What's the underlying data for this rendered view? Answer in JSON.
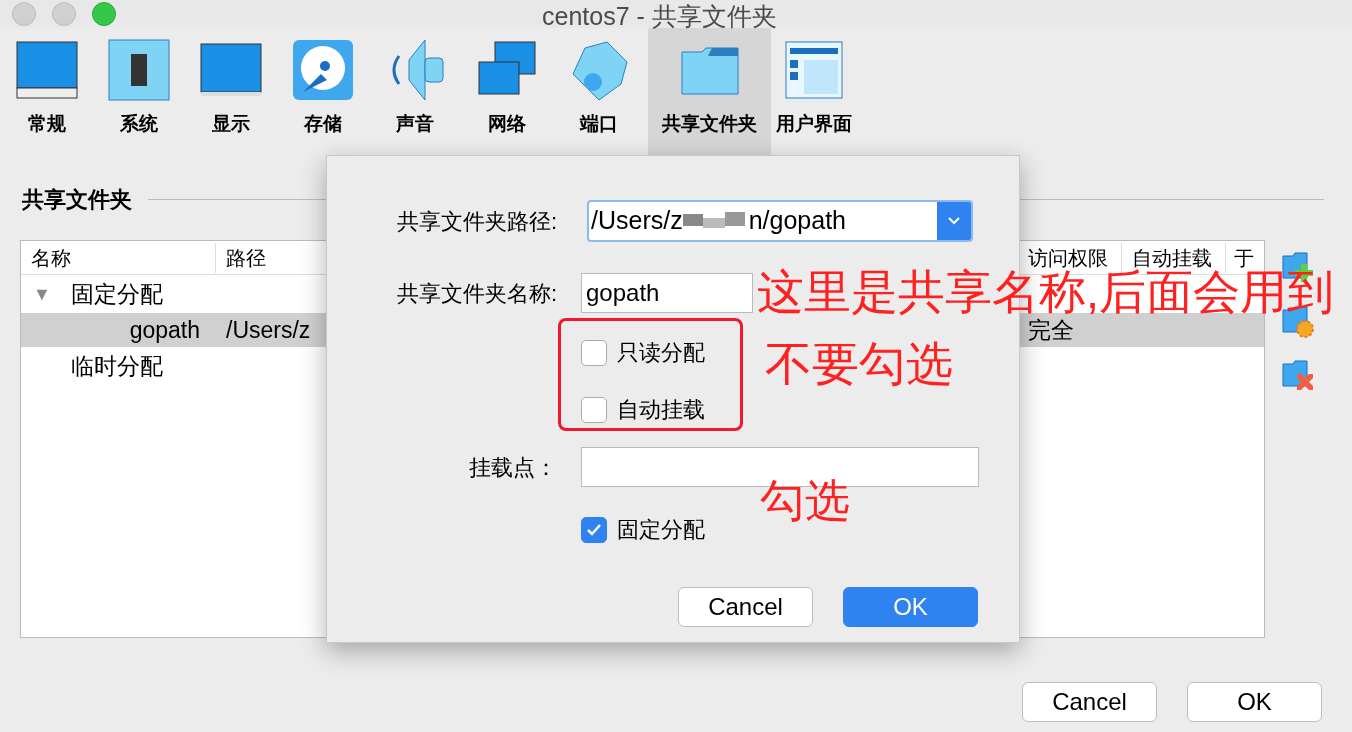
{
  "window": {
    "title": "centos7 - 共享文件夹"
  },
  "toolbar": [
    {
      "label": "常规",
      "kind": "general",
      "selected": false
    },
    {
      "label": "系统",
      "kind": "system",
      "selected": false
    },
    {
      "label": "显示",
      "kind": "display",
      "selected": false
    },
    {
      "label": "存储",
      "kind": "storage",
      "selected": false
    },
    {
      "label": "声音",
      "kind": "audio",
      "selected": false
    },
    {
      "label": "网络",
      "kind": "network",
      "selected": false
    },
    {
      "label": "端口",
      "kind": "ports",
      "selected": false
    },
    {
      "label": "共享文件夹",
      "kind": "shared",
      "selected": true
    },
    {
      "label": "用户界面",
      "kind": "ui",
      "selected": false
    }
  ],
  "section_title": "共享文件夹",
  "table": {
    "columns": [
      "名称",
      "路径",
      "访问权限",
      "自动挂载",
      "于"
    ],
    "groups": [
      {
        "label": "固定分配",
        "toggle": "▼",
        "expanded": true,
        "children": [
          {
            "name": "gopath",
            "path": "/Users/z",
            "access": "完全",
            "selected": true
          }
        ]
      },
      {
        "label": "临时分配"
      }
    ]
  },
  "dialog": {
    "fields": [
      {
        "kind": "combo",
        "label": "共享文件夹路径:",
        "value_start": "/Users/z",
        "value_end": "n/gopath"
      },
      {
        "kind": "text",
        "label": "共享文件夹名称:",
        "value": "gopath"
      },
      {
        "kind": "checkbox",
        "label": "只读分配",
        "checked": false
      },
      {
        "kind": "checkbox",
        "label": "自动挂载",
        "checked": false
      },
      {
        "kind": "text",
        "label": "挂载点："
      },
      {
        "kind": "checkbox",
        "label": "固定分配",
        "checked": true
      }
    ],
    "buttons": [
      {
        "label": "Cancel",
        "kind": "secondary"
      },
      {
        "label": "OK",
        "kind": "primary"
      }
    ]
  },
  "annotations": [
    "这里是共享名称,后面会用到",
    "不要勾选",
    "勾选"
  ],
  "footer_buttons": [
    {
      "label": "Cancel",
      "kind": "secondary"
    },
    {
      "label": "OK",
      "kind": "secondary"
    }
  ]
}
